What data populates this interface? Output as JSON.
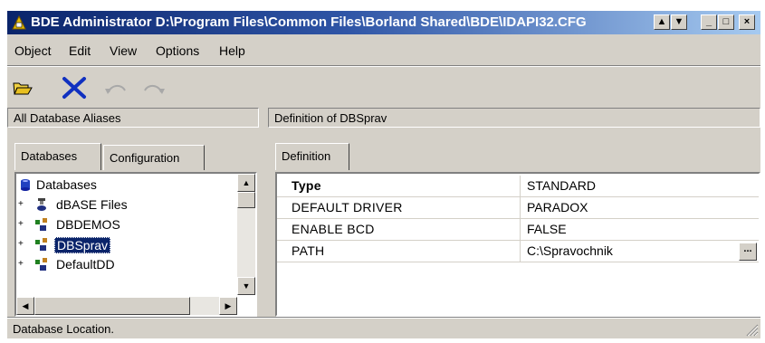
{
  "window": {
    "title": "BDE Administrator  D:\\Program Files\\Common Files\\Borland Shared\\BDE\\IDAPI32.CFG",
    "btn_up": "▲",
    "btn_down": "▼",
    "btn_min": "_",
    "btn_max": "□",
    "btn_close": "×"
  },
  "menu": [
    {
      "label": "Object"
    },
    {
      "label": "Edit"
    },
    {
      "label": "View"
    },
    {
      "label": "Options"
    },
    {
      "label": "Help"
    }
  ],
  "toolbar": {
    "open_icon": "folder-open-icon",
    "delete_icon": "delete-x-icon",
    "undo_icon": "undo-icon",
    "redo_icon": "redo-icon"
  },
  "left_panel": {
    "header": "All Database Aliases",
    "tabs": [
      {
        "label": "Databases",
        "active": true
      },
      {
        "label": "Configuration",
        "active": false
      }
    ],
    "tree": [
      {
        "label": "Databases",
        "icon": "databases-root-icon",
        "expander": "",
        "selected": false
      },
      {
        "label": "dBASE Files",
        "icon": "database-alias-icon",
        "expander": "+",
        "selected": false
      },
      {
        "label": "DBDEMOS",
        "icon": "database-alias-icon",
        "expander": "+",
        "selected": false
      },
      {
        "label": "DBSprav",
        "icon": "database-alias-icon",
        "expander": "+",
        "selected": true
      },
      {
        "label": "DefaultDD",
        "icon": "database-alias-icon",
        "expander": "+",
        "selected": false
      }
    ]
  },
  "right_panel": {
    "header": "Definition of DBSprav",
    "tab": "Definition",
    "rows": [
      {
        "name": "Type",
        "value": "STANDARD",
        "bold": true
      },
      {
        "name": "DEFAULT DRIVER",
        "value": "PARADOX",
        "bold": false
      },
      {
        "name": "ENABLE BCD",
        "value": "FALSE",
        "bold": false
      },
      {
        "name": "PATH",
        "value": "C:\\Spravochnik",
        "bold": false
      }
    ],
    "ellipsis_label": "..."
  },
  "status": {
    "text": "Database Location."
  },
  "colors": {
    "title_start": "#0a246a",
    "title_end": "#a6caf0",
    "face": "#d4d0c8",
    "selection": "#0a246a"
  }
}
